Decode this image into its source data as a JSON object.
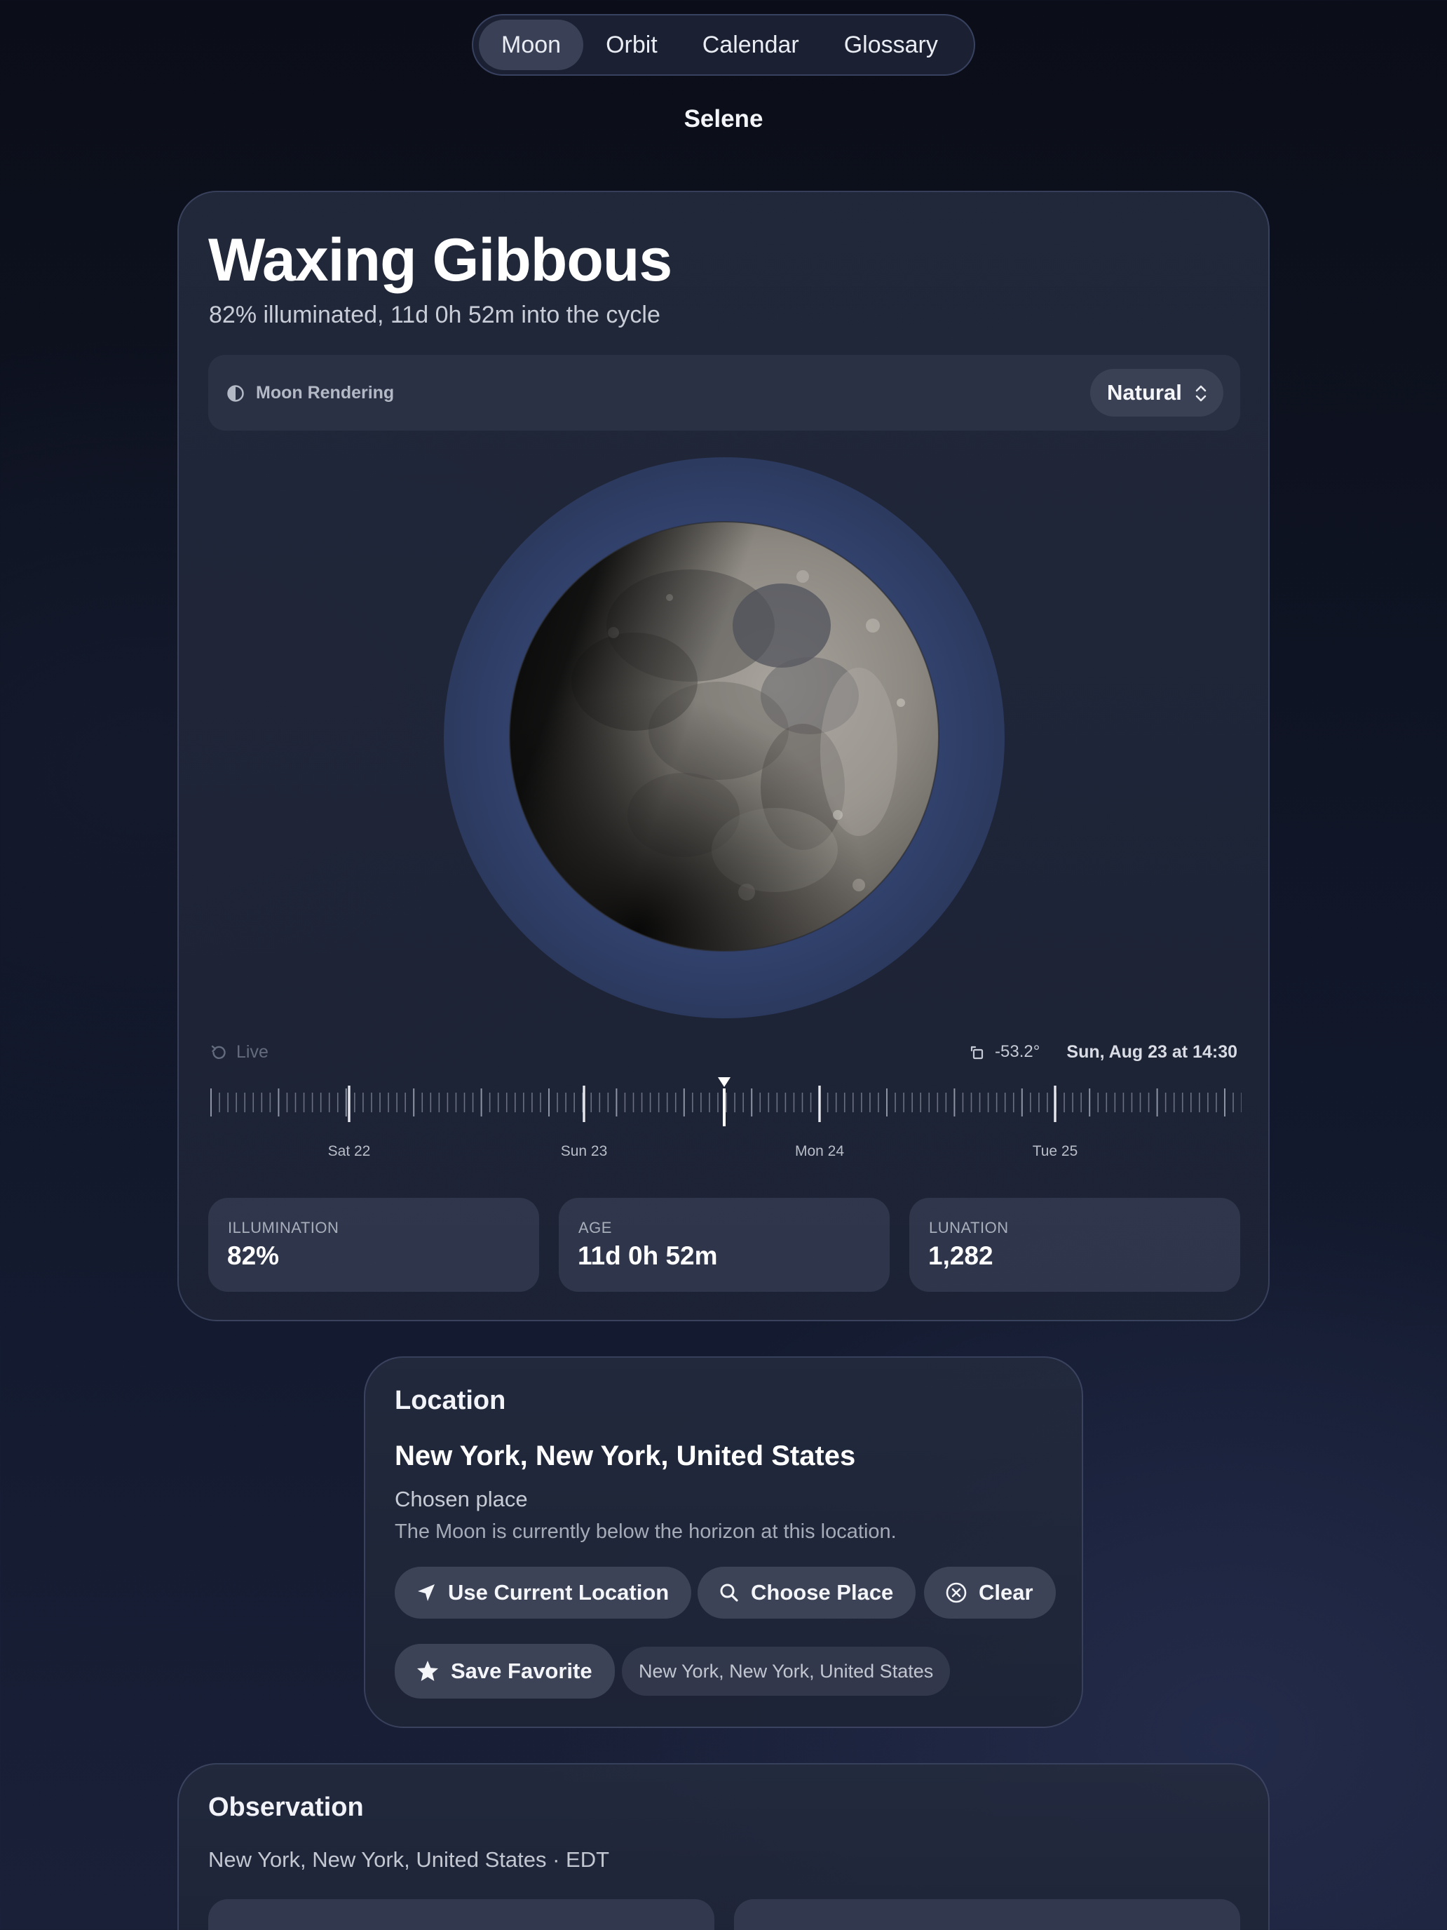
{
  "tabs": [
    {
      "label": "Moon",
      "active": true
    },
    {
      "label": "Orbit",
      "active": false
    },
    {
      "label": "Calendar",
      "active": false
    },
    {
      "label": "Glossary",
      "active": false
    }
  ],
  "app_title": "Selene",
  "phase": {
    "name": "Waxing Gibbous",
    "subtitle": "82% illuminated, 11d 0h 52m into the cycle"
  },
  "rendering": {
    "icon": "half-circle-icon",
    "label": "Moon Rendering",
    "selected": "Natural"
  },
  "timeline": {
    "live_label": "Live",
    "angle": "-53.2°",
    "datetime": "Sun, Aug 23 at 14:30",
    "day_labels": [
      "Sat 22",
      "Sun 23",
      "Mon 24",
      "Tue 25"
    ]
  },
  "stats": [
    {
      "label": "ILLUMINATION",
      "value": "82%"
    },
    {
      "label": "AGE",
      "value": "11d 0h 52m"
    },
    {
      "label": "LUNATION",
      "value": "1,282"
    }
  ],
  "location": {
    "heading": "Location",
    "place": "New York, New York, United States",
    "source": "Chosen place",
    "note": "The Moon is currently below the horizon at this location.",
    "buttons": {
      "use_current": "Use Current Location",
      "choose": "Choose Place",
      "clear": "Clear",
      "save_favorite": "Save Favorite"
    },
    "favorite_chip": "New York, New York, United States"
  },
  "observation": {
    "heading": "Observation",
    "subtitle": "New York, New York, United States · EDT"
  },
  "colors": {
    "accent_halo": "#34466f",
    "card_bg": "#242b3e",
    "pill_bg": "#3c4357"
  }
}
